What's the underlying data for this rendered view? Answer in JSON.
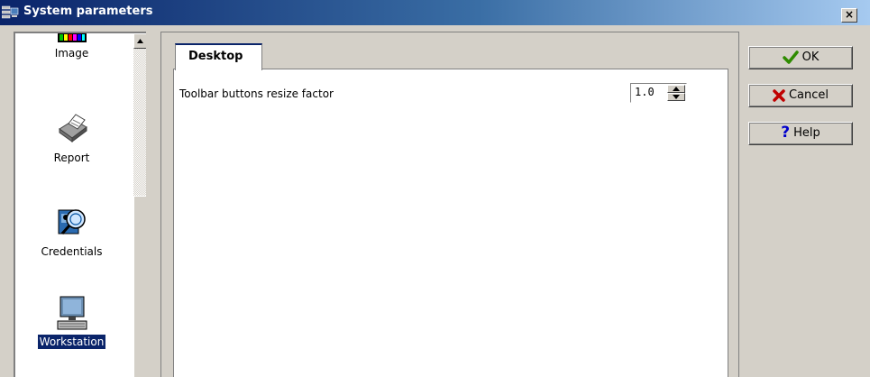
{
  "window": {
    "title": "System parameters",
    "close_label": "×"
  },
  "nav": {
    "items": [
      {
        "label": "Image",
        "icon": "palette-icon",
        "selected": false
      },
      {
        "label": "Report",
        "icon": "printer-icon",
        "selected": false
      },
      {
        "label": "Credentials",
        "icon": "credentials-icon",
        "selected": false
      },
      {
        "label": "Workstation",
        "icon": "computer-icon",
        "selected": true
      }
    ]
  },
  "tabs": [
    {
      "label": "Desktop",
      "active": true
    }
  ],
  "settings": {
    "toolbar_resize_label": "Toolbar buttons resize factor",
    "toolbar_resize_value": "1.0"
  },
  "buttons": {
    "ok": "OK",
    "cancel": "Cancel",
    "help": "Help"
  },
  "colors": {
    "title_bar_start": "#0a246a",
    "title_bar_end": "#a6caf0",
    "selection": "#0a246a",
    "dialog_bg": "#d4d0c8",
    "ok_icon": "#2e8b00",
    "cancel_icon": "#c00000",
    "help_icon": "#0000cc"
  }
}
